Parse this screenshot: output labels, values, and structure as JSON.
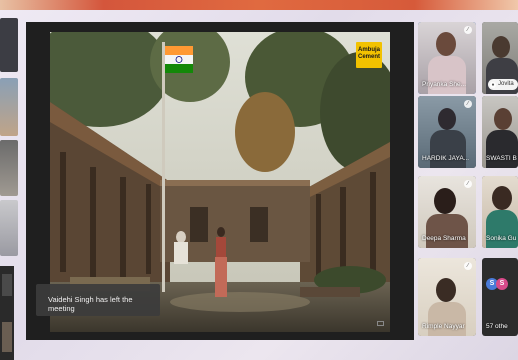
{
  "main_video": {
    "logo_line1": "Ambuja",
    "logo_line2": "Cement",
    "notification": "Vaidehi Singh has left the meeting"
  },
  "participants": [
    {
      "name": "Priyanka She...",
      "active": true
    },
    {
      "name": "Jovita",
      "active": false
    },
    {
      "name": "HARDIK JAYA...",
      "active": false
    },
    {
      "name": "SWASTI B",
      "active": false
    },
    {
      "name": "Deepa Sharma",
      "active": false
    },
    {
      "name": "Sonika Gu",
      "active": false
    },
    {
      "name": "Rimple Nayyar",
      "active": false
    }
  ],
  "others": {
    "label": "57 othe",
    "avatar_letters": [
      "S",
      "S"
    ]
  },
  "colors": {
    "accent": "#2f6fd8",
    "panel_bg": "#1f1f1f",
    "logo_yellow": "#f2c200"
  }
}
